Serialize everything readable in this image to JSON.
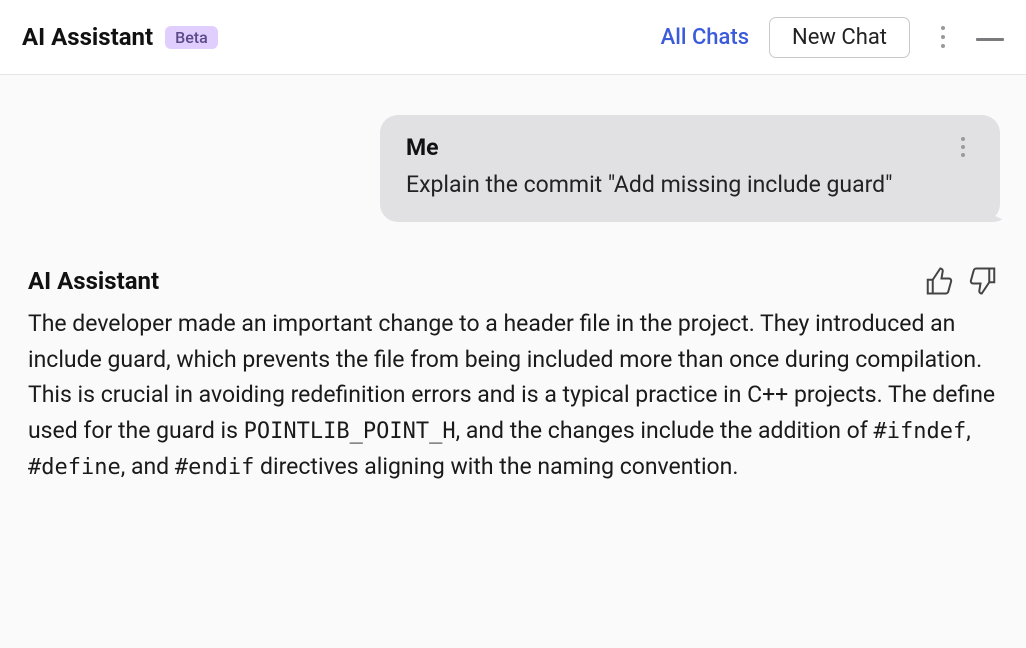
{
  "header": {
    "title": "AI Assistant",
    "badge": "Beta",
    "allChats": "All Chats",
    "newChat": "New Chat"
  },
  "conversation": {
    "me": {
      "label": "Me",
      "text": "Explain the commit \"Add missing include guard\""
    },
    "ai": {
      "label": "AI Assistant",
      "part1": "The developer made an important change to a header file in the project. They introduced an include guard, which prevents the file from being included more than once during compilation. This is crucial in avoiding redefinition errors and is a typical practice in C++ projects. The define used for the guard is ",
      "code1": "POINTLIB_POINT_H",
      "part2": ", and the changes include the addition of ",
      "code2": "#ifndef",
      "part3": ", ",
      "code3": "#define",
      "part4": ", and ",
      "code4": "#endif",
      "part5": " directives aligning with the naming convention."
    }
  }
}
